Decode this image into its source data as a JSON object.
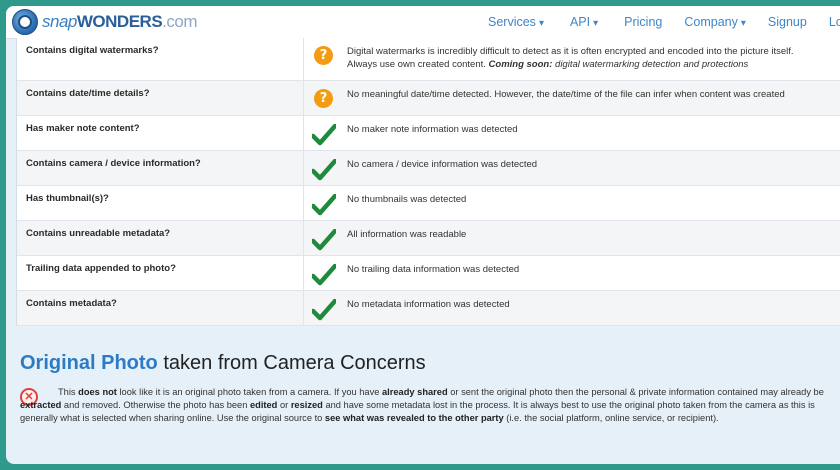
{
  "nav": {
    "logo": {
      "snap": "snap",
      "wonders": "WONDERS",
      "tld": ".com"
    },
    "items": [
      {
        "label": "Services",
        "dropdown": true
      },
      {
        "label": "API",
        "dropdown": true
      },
      {
        "label": "Pricing",
        "dropdown": false
      },
      {
        "label": "Company",
        "dropdown": true
      },
      {
        "label": "Signup",
        "dropdown": false
      },
      {
        "label": "Logi",
        "dropdown": false
      }
    ]
  },
  "checks": [
    {
      "question": "Contains digital watermarks?",
      "status": "question",
      "answer": "Digital watermarks is incredibly difficult to detect as it is often encrypted and encoded into the picture itself.",
      "answer2_pre": "Always use own created content. ",
      "answer2_bold": "Coming soon:",
      "answer2_post": " digital watermarking detection and protections"
    },
    {
      "question": "Contains date/time details?",
      "status": "question",
      "answer": "No meaningful date/time detected. However, the date/time of the file can infer when content was created"
    },
    {
      "question": "Has maker note content?",
      "status": "ok",
      "answer": "No maker note information was detected"
    },
    {
      "question": "Contains camera / device information?",
      "status": "ok",
      "answer": "No camera / device information was detected"
    },
    {
      "question": "Has thumbnail(s)?",
      "status": "ok",
      "answer": "No thumbnails was detected"
    },
    {
      "question": "Contains unreadable metadata?",
      "status": "ok",
      "answer": "All information was readable"
    },
    {
      "question": "Trailing data appended to photo?",
      "status": "ok",
      "answer": "No trailing data information was detected"
    },
    {
      "question": "Contains metadata?",
      "status": "ok",
      "answer": "No metadata information was detected"
    }
  ],
  "concern": {
    "title_highlight": "Original Photo",
    "title_rest": " taken from Camera Concerns",
    "icon": "x-circle-icon",
    "text_parts": [
      {
        "t": "This ",
        "b": false
      },
      {
        "t": "does not",
        "b": true
      },
      {
        "t": " look like it is an original photo taken from a camera. If you have ",
        "b": false
      },
      {
        "t": "already shared",
        "b": true
      },
      {
        "t": " or sent the original photo then the personal & private information contained may already be ",
        "b": false
      },
      {
        "t": "extracted",
        "b": true
      },
      {
        "t": " and removed. Otherwise the photo has been ",
        "b": false
      },
      {
        "t": "edited",
        "b": true
      },
      {
        "t": " or ",
        "b": false
      },
      {
        "t": "resized",
        "b": true
      },
      {
        "t": " and have some metadata lost in the process. It is always best to use the original photo taken from the camera as this is generally what is selected when sharing online. Use the original source to ",
        "b": false
      },
      {
        "t": "see what was revealed to the other party",
        "b": true
      },
      {
        "t": " (i.e. the social platform, online service, or recipient).",
        "b": false
      }
    ]
  },
  "colors": {
    "accent": "#2d7bc4",
    "warning": "#f39c12",
    "ok": "#1f8a3c",
    "error": "#e0413a",
    "frame": "#2f9a8c"
  }
}
